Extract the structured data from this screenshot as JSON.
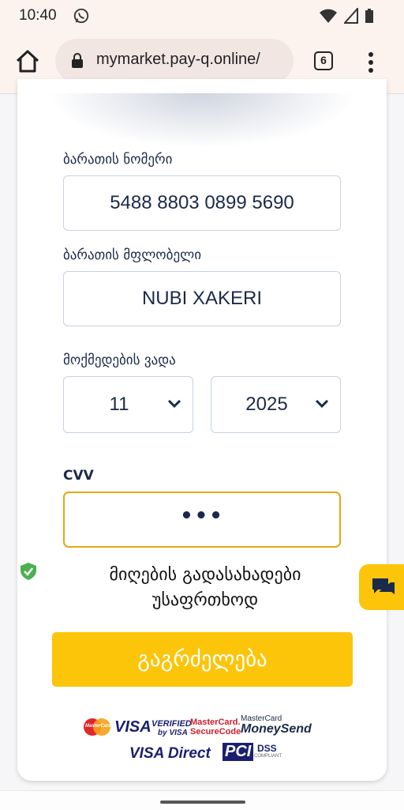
{
  "status_bar": {
    "time": "10:40"
  },
  "browser": {
    "url": "mymarket.pay-q.online/",
    "tab_count": "6"
  },
  "form": {
    "card_number_label": "ბარათის ნომერი",
    "card_number": "5488 8803 0899 5690",
    "card_holder_label": "ბარათის მფლობელი",
    "card_holder": "NUBI XAKERI",
    "expiry_label": "მოქმედების ვადა",
    "expiry_month": "11",
    "expiry_year": "2025",
    "cvv_label": "CVV",
    "cvv_value": "•••",
    "secure_line1": "მიღების გადასახადები",
    "secure_line2": "უსაფრთხოდ",
    "continue_label": "გაგრძელება"
  },
  "payment_logos": {
    "mastercard": "MasterCard",
    "visa": "VISA",
    "verified_by_visa_1": "VERIFIED",
    "verified_by_visa_2": "by VISA",
    "securecode_1": "MasterCard.",
    "securecode_2": "SecureCode",
    "moneysend_1": "MasterCard",
    "moneysend_2": "MoneySend",
    "visa_direct": "VISA Direct",
    "pci": "PCI",
    "dss": "DSS",
    "compliant": "COMPLIANT"
  },
  "colors": {
    "accent": "#fcc50a",
    "focus_border": "#e2a812",
    "text": "#1b2a4a",
    "secure_green": "#4caf50"
  }
}
